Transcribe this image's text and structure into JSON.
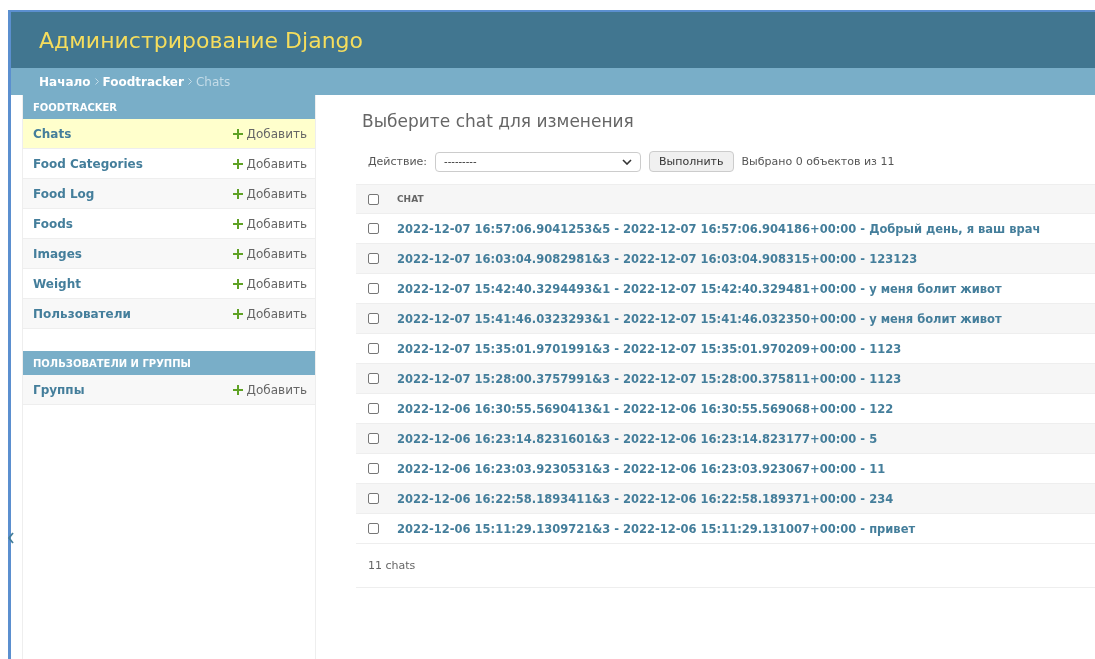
{
  "header": {
    "title": "Администрирование Django"
  },
  "breadcrumbs": [
    {
      "label": "Начало",
      "current": false
    },
    {
      "label": "Foodtracker",
      "current": false
    },
    {
      "label": "Chats",
      "current": true
    }
  ],
  "sidebar": {
    "modules": [
      {
        "caption": "FOODTRACKER",
        "items": [
          {
            "label": "Chats",
            "add": "Добавить",
            "selected": true
          },
          {
            "label": "Food Categories",
            "add": "Добавить",
            "selected": false
          },
          {
            "label": "Food Log",
            "add": "Добавить",
            "selected": false
          },
          {
            "label": "Foods",
            "add": "Добавить",
            "selected": false
          },
          {
            "label": "Images",
            "add": "Добавить",
            "selected": false
          },
          {
            "label": "Weight",
            "add": "Добавить",
            "selected": false
          },
          {
            "label": "Пользователи",
            "add": "Добавить",
            "selected": false
          }
        ]
      },
      {
        "caption": "ПОЛЬЗОВАТЕЛИ И ГРУППЫ",
        "items": [
          {
            "label": "Группы",
            "add": "Добавить",
            "selected": false
          }
        ]
      }
    ]
  },
  "content": {
    "title": "Выберите chat для изменения",
    "actions": {
      "label": "Действие:",
      "select_value": "---------",
      "button": "Выполнить",
      "counter": "Выбрано 0 объектов из 11"
    },
    "table": {
      "select_all_checked": false,
      "columns": [
        "CHAT"
      ],
      "rows": [
        {
          "text": "2022-12-07 16:57:06.9041253&5 - 2022-12-07 16:57:06.904186+00:00 - Добрый день, я ваш врач",
          "checked": false
        },
        {
          "text": "2022-12-07 16:03:04.9082981&3 - 2022-12-07 16:03:04.908315+00:00 - 123123",
          "checked": false
        },
        {
          "text": "2022-12-07 15:42:40.3294493&1 - 2022-12-07 15:42:40.329481+00:00 - у меня болит живот",
          "checked": false
        },
        {
          "text": "2022-12-07 15:41:46.0323293&1 - 2022-12-07 15:41:46.032350+00:00 - у меня болит живот",
          "checked": false
        },
        {
          "text": "2022-12-07 15:35:01.9701991&3 - 2022-12-07 15:35:01.970209+00:00 - 1123",
          "checked": false
        },
        {
          "text": "2022-12-07 15:28:00.3757991&3 - 2022-12-07 15:28:00.375811+00:00 - 1123",
          "checked": false
        },
        {
          "text": "2022-12-06 16:30:55.5690413&1 - 2022-12-06 16:30:55.569068+00:00 - 122",
          "checked": false
        },
        {
          "text": "2022-12-06 16:23:14.8231601&3 - 2022-12-06 16:23:14.823177+00:00 - 5",
          "checked": false
        },
        {
          "text": "2022-12-06 16:23:03.9230531&3 - 2022-12-06 16:23:03.923067+00:00 - 11",
          "checked": false
        },
        {
          "text": "2022-12-06 16:22:58.1893411&3 - 2022-12-06 16:22:58.189371+00:00 - 234",
          "checked": false
        },
        {
          "text": "2022-12-06 15:11:29.1309721&3 - 2022-12-06 15:11:29.131007+00:00 - привет",
          "checked": false
        }
      ]
    },
    "paginator": "11 chats"
  }
}
